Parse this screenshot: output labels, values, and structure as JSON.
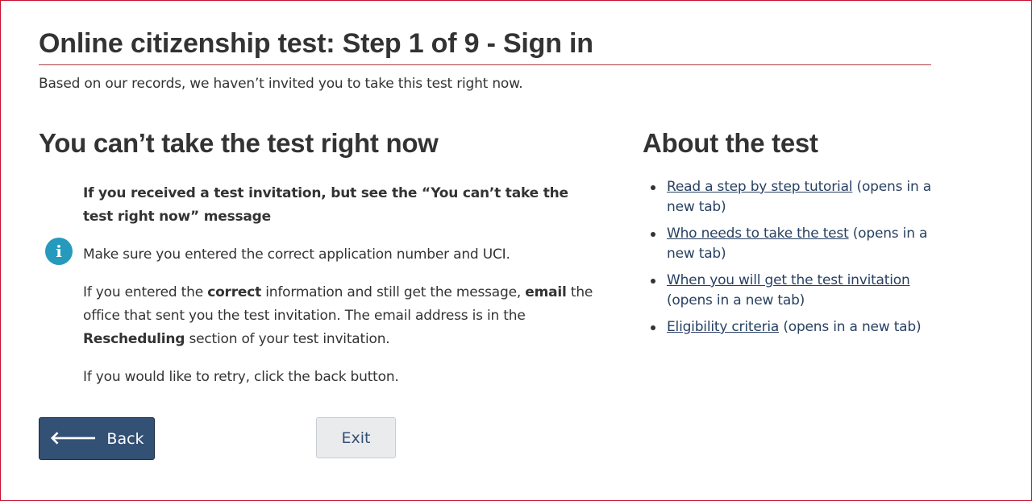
{
  "header": {
    "title": "Online citizenship test: Step 1 of 9 - Sign in",
    "intro": "Based on our records, we haven’t invited you to take this test right now."
  },
  "main": {
    "heading": "You can’t take the test right now",
    "alert": {
      "icon": "info-icon",
      "icon_glyph": "i",
      "title": "If you received a test invitation, but see the “You can’t take the test right now” message",
      "p1": "Make sure you entered the correct application number and UCI.",
      "p2_a": "If you entered the ",
      "p2_b": "correct",
      "p2_c": " information and still get the message, ",
      "p2_d": "email",
      "p2_e": " the office that sent you the test invitation. The email address is in the ",
      "p2_f": "Rescheduling",
      "p2_g": " section of your test invitation.",
      "p3": "If you would like to retry, click the back button."
    }
  },
  "sidebar": {
    "heading": "About the test",
    "links": [
      {
        "label": "Read a step by step tutorial",
        "suffix": " (opens in a new tab)"
      },
      {
        "label": "Who needs to take the test",
        "suffix": " (opens in a new tab)"
      },
      {
        "label": "When you will get the test invitation",
        "suffix": " (opens in a new tab)"
      },
      {
        "label": "Eligibility criteria",
        "suffix": " (opens in a new tab)"
      }
    ]
  },
  "buttons": {
    "back_label": "Back",
    "back_icon": "arrow-left-icon",
    "exit_label": "Exit"
  },
  "colors": {
    "primary_button": "#335075",
    "link": "#284162",
    "info": "#269abc",
    "rule": "#af3c43"
  }
}
